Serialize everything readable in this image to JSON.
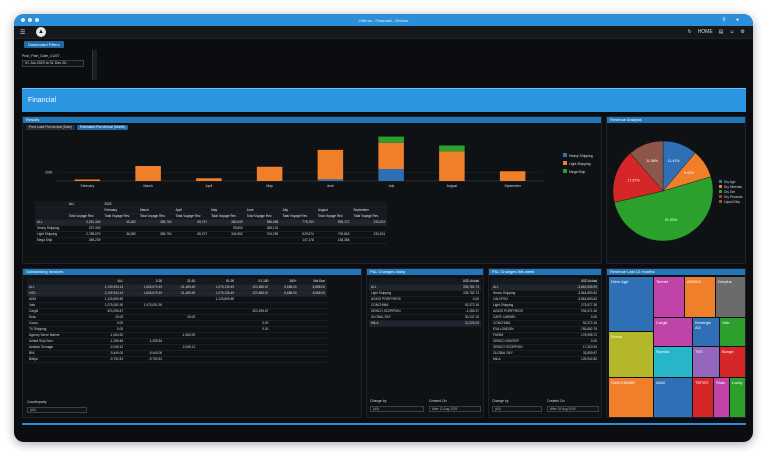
{
  "window": {
    "title": "Orthrus - Financial - Orthrus"
  },
  "appbar": {
    "home_label": "HOME"
  },
  "tabs": [
    {
      "label": "Dashboard Filters"
    }
  ],
  "filter": {
    "label": "Post_Pain_Date_CUST",
    "value": "01 Jun 2023 to 31 Dec 20.."
  },
  "banner": {
    "title": "Financial"
  },
  "results": {
    "title": "Results",
    "subtabs": [
      "Post Load Port Arrival (Date)",
      "Estimated Port Arrival (Month)"
    ],
    "legend": [
      "Heavy Shipping",
      "Light Shipping",
      "Mega Ship"
    ],
    "colors": {
      "heavy": "#2f6fb5",
      "light": "#f07f2a",
      "mega": "#2ca02c"
    },
    "table": {
      "col_all": "ALL",
      "col_year": "2023",
      "months": [
        "February",
        "March",
        "April",
        "May",
        "June",
        "July",
        "August",
        "September"
      ],
      "measure": "Total Voyage Rev.",
      "rows": [
        {
          "label": "ALL",
          "vals": [
            "5,251,446",
            "36,082",
            "358,754",
            "65,747",
            "380,649",
            "986,685",
            "776,763",
            "899,172",
            "233,204"
          ]
        },
        {
          "label": "Heavy Shipping",
          "vals": [
            "297,339",
            "",
            "",
            "",
            "39,804",
            "285,131",
            "",
            "",
            ""
          ]
        },
        {
          "label": "Light Shipping",
          "vals": [
            "2,788,679",
            "36,082",
            "358,754",
            "65,747",
            "340,552",
            "704,255",
            "629,574",
            "709,816",
            "233,204"
          ]
        },
        {
          "label": "Mega Ship",
          "vals": [
            "265,239",
            "",
            "",
            "",
            "",
            "",
            "147,178",
            "138,368",
            ""
          ]
        }
      ]
    }
  },
  "chart_data": [
    {
      "type": "bar",
      "title": "",
      "categories": [
        "February",
        "March",
        "April",
        "May",
        "June",
        "July",
        "August",
        "September"
      ],
      "series": [
        {
          "name": "Heavy Shipping",
          "values": [
            0,
            0,
            0,
            0,
            39804,
            285131,
            0,
            0
          ]
        },
        {
          "name": "Light Shipping",
          "values": [
            36082,
            358754,
            65747,
            340552,
            704255,
            629574,
            709816,
            233204
          ]
        },
        {
          "name": "Mega Ship",
          "values": [
            0,
            0,
            0,
            0,
            0,
            147178,
            138368,
            0
          ]
        }
      ],
      "ytick_label": "200k",
      "stacked": true
    },
    {
      "type": "pie",
      "title": "Revenue Analysis",
      "labels": [
        "Dry Agri",
        "Dry Minerals",
        "Dry Ore",
        "Dry Products",
        "Liquid Dirty"
      ],
      "values": [
        11.4,
        9.4,
        51.9,
        17.6,
        11.6
      ],
      "value_labels": [
        "11.43%",
        "9.43%",
        "51.93%",
        "17.57%",
        "11.58%"
      ],
      "colors": [
        "#2f6fb5",
        "#f07f2a",
        "#2ca02c",
        "#d62728",
        "#8c564b"
      ]
    }
  ],
  "outstanding": {
    "title": "Outstanding Invoices",
    "columns": [
      "ALL",
      "0-30",
      "31-60",
      "61-90",
      "91-180",
      "365+",
      "Not Due"
    ],
    "rows": [
      {
        "label": "ALL",
        "vals": [
          "2,149,934.14",
          "1,806,679.49",
          "-31,480.69",
          "1,075,136.49",
          "323,685.67",
          "8,688.00",
          "8,688.00"
        ],
        "neg": [
          false,
          false,
          true,
          false,
          false,
          true,
          true
        ]
      },
      {
        "label": "USD",
        "vals": [
          "2,149,934.14",
          "1,806,679.49",
          "-31,480.69",
          "1,075,136.49",
          "323,685.67",
          "8,688.00",
          "8,688.00"
        ],
        "neg": [
          false,
          false,
          true,
          false,
          false,
          true,
          true
        ]
      },
      {
        "label": "ADM",
        "vals": [
          "1,125,899.89",
          "",
          "",
          "1,125,899.89",
          "",
          "",
          ""
        ],
        "neg": []
      },
      {
        "label": "Vale",
        "vals": [
          "1,075,051.90",
          "1,075,051.90",
          "",
          "",
          "",
          "",
          ""
        ],
        "neg": []
      },
      {
        "label": "Cargill",
        "vals": [
          "323,295.67",
          "",
          "",
          "",
          "323,295.67",
          "",
          ""
        ],
        "neg": []
      },
      {
        "label": "Dras",
        "vals": [
          "20.00",
          "",
          "20.00",
          "",
          "",
          "",
          ""
        ],
        "neg": []
      },
      {
        "label": "Cosco",
        "vals": [
          "0.00",
          "",
          "",
          "",
          "0.00",
          "",
          ""
        ],
        "neg": []
      },
      {
        "label": "TK Shipping",
        "vals": [
          "0.00",
          "",
          "",
          "",
          "0.00",
          "",
          ""
        ],
        "neg": []
      },
      {
        "label": "Agency Serve Marine",
        "vals": [
          "-1,064.92",
          "",
          "-1,064.92",
          "",
          "",
          "",
          ""
        ],
        "neg": [
          true,
          false,
          true
        ]
      },
      {
        "label": "United Ship Serv.",
        "vals": [
          "-1,259.84",
          "-1,259.84",
          "",
          "",
          "",
          "",
          ""
        ],
        "neg": [
          true,
          true
        ]
      },
      {
        "label": "Andean Tonnage",
        "vals": [
          "-2,045.12",
          "",
          "-2,045.12",
          "",
          "",
          "",
          ""
        ],
        "neg": [
          true,
          false,
          true
        ]
      },
      {
        "label": "BHL",
        "vals": [
          "-9,440.00",
          "-9,440.00",
          "",
          "",
          "",
          "",
          ""
        ],
        "neg": [
          true,
          true
        ]
      },
      {
        "label": "Bidiya",
        "vals": [
          "-9,752.81",
          "-9,752.81",
          "",
          "",
          "",
          "",
          ""
        ],
        "neg": [
          true,
          true
        ]
      }
    ],
    "counterparty_label": "Counterparty",
    "counterparty_value": "(All)"
  },
  "pl_today": {
    "title": "P&L Changes today",
    "col": "USD Actual",
    "rows": [
      {
        "label": "ALL",
        "val": "335,782.73"
      },
      {
        "label": "Light Shipping",
        "val": "335,782.73"
      },
      {
        "label": "AGIOS PORFYRIOS",
        "val": "0.00"
      },
      {
        "label": "CONCHIMA",
        "val": "92,372.16"
      },
      {
        "label": "GENCO SCORPION",
        "val": "-1,285.37"
      },
      {
        "label": "GLOBAL SKY",
        "val": "30,137.15"
      },
      {
        "label": "MILA",
        "val": "21,226.33"
      }
    ],
    "change_by_label": "Change by",
    "change_by_value": "(All)",
    "created_on_label": "Created On",
    "created_on_value": "After 11 Aug 2025"
  },
  "pl_week": {
    "title": "P&L Changes this week",
    "col": "USD Actual",
    "rows": [
      {
        "label": "ALL",
        "val": "-3,862,835.99"
      },
      {
        "label": "Heavy Shipping",
        "val": "-3,864,853.83"
      },
      {
        "label": "CALYPSO",
        "val": "-3,864,853.83"
      },
      {
        "label": "Light Shipping",
        "val": "273,577.36"
      },
      {
        "label": "AGIOS PORFYRIOS",
        "val": "294,471.06"
      },
      {
        "label": "CAPE CARMEL",
        "val": "0.00"
      },
      {
        "label": "CONCHIMA",
        "val": "92,372.16"
      },
      {
        "label": "EVA LONDON",
        "val": "-765,682.76"
      },
      {
        "label": "FURIM",
        "val": "176,908.72"
      },
      {
        "label": "GENCO HUNTER",
        "val": "0.00"
      },
      {
        "label": "GENCO SCORPION",
        "val": "17,310.94"
      },
      {
        "label": "GLOBAL SKY",
        "val": "33,809.87"
      },
      {
        "label": "MILA",
        "val": "125,942.82"
      }
    ],
    "change_by_label": "Change by",
    "change_by_value": "(All)",
    "created_on_label": "Created On",
    "created_on_value": "After 18 Aug 2025"
  },
  "revenue12": {
    "title": "Revenue Last 12 months",
    "tiles": [
      "Diem Agri",
      "Tennet",
      "ADMDC",
      "Dreyfus",
      "Cargill",
      "Kenergis AG",
      "Valc",
      "Exxon",
      "Rumba",
      "TKS",
      "Bunge",
      "SANCHIMAR",
      "ADM",
      "TEPZO",
      "Shan",
      "Lucky"
    ]
  }
}
